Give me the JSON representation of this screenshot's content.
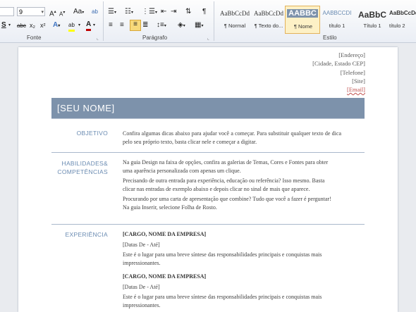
{
  "ribbon": {
    "font_size": "9",
    "group_labels": {
      "font": "Fonte",
      "paragraph": "Parágrafo",
      "styles": "Estilo"
    },
    "font_glyphs": {
      "grow": "A",
      "shrink": "A",
      "change_case": "Aa",
      "clear": "ab",
      "strikethrough": "abc",
      "subscript": "x₂",
      "superscript": "x²",
      "text_effects": "A",
      "highlight": "ab",
      "font_color": "A",
      "underline": "S"
    },
    "styles": [
      {
        "sample": "AaBbCcDd",
        "name": "¶ Normal"
      },
      {
        "sample": "AaBbCcDd",
        "name": "¶ Texto do..."
      },
      {
        "sample": "AABBC",
        "name": "¶ Nome"
      },
      {
        "sample": "AABBCCDI",
        "name": "título 1"
      },
      {
        "sample": "AaBbC",
        "name": "Título 1"
      },
      {
        "sample": "AaBbCcDd",
        "name": "título 2"
      }
    ],
    "colors": {
      "highlight": "#ffff00",
      "font_color": "#c00000",
      "active": "#f7d97a"
    }
  },
  "document": {
    "contact": {
      "address": "[Endereço]",
      "city": "[Cidade, Estado CEP]",
      "phone": "[Telefone]",
      "site": "[Site]",
      "email": "[Email]"
    },
    "name": "[SEU NOME]",
    "colors": {
      "name_bar": "#7d92ab",
      "section_label": "#6a8bb2"
    },
    "objective": {
      "label": "OBJETIVO",
      "text": "Confira algumas dicas abaixo para ajudar você a começar. Para substituir qualquer texto de dica pelo seu próprio texto, basta clicar nele e começar a digitar."
    },
    "skills": {
      "label_line1": "HABILIDADES&",
      "label_line2": "COMPETÊNCIAS",
      "paragraphs": [
        "Na guia Design na faixa de opções, confira as galerias de Temas, Cores e Fontes para obter uma aparência personalizada com apenas um clique.",
        "Precisando de outra entrada para experiência, educação ou referência? Isso mesmo. Basta clicar nas entradas de exemplo abaixo e depois clicar no sinal de mais que aparece.",
        "Procurando por uma carta de apresentação que combine? Tudo que você a fazer é perguntar! Na guia Inserir, selecione Folha de Rosto."
      ]
    },
    "experience": {
      "label": "EXPERIÊNCIA",
      "jobs": [
        {
          "title": "[CARGO, NOME DA EMPRESA]",
          "dates": "[Datas De - Até]",
          "description": "Este é o lugar para uma breve síntese das responsabilidades principais e conquistas mais impressionantes."
        },
        {
          "title": "[CARGO, NOME DA EMPRESA]",
          "dates": "[Datas De - Até]",
          "description": "Este é o lugar para uma breve síntese das responsabilidades principais e conquistas mais impressionantes."
        }
      ]
    }
  }
}
